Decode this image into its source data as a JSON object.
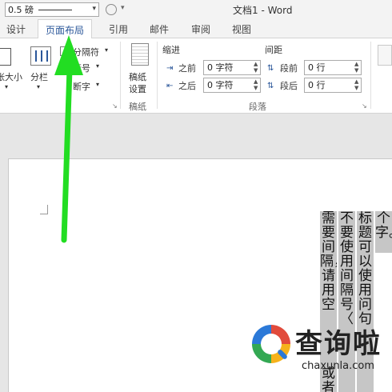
{
  "toolbar": {
    "border_weight": "0.5 磅",
    "circle_caret": "▾",
    "combo_caret": "▾"
  },
  "window": {
    "title": "文档1 - Word"
  },
  "tabs": [
    {
      "label": "设计"
    },
    {
      "label": "页面布局"
    },
    {
      "label": "引用"
    },
    {
      "label": "邮件"
    },
    {
      "label": "审阅"
    },
    {
      "label": "视图"
    }
  ],
  "ribbon": {
    "page_setup": {
      "size": "纸张大小",
      "size_caret": "▾",
      "columns": "分栏",
      "columns_caret": "▾",
      "breaks": "分隔符",
      "breaks_caret": "▾",
      "line_numbers": "行号",
      "line_numbers_caret": "▾",
      "hyphenation": "断字",
      "hyphenation_caret": "▾",
      "launcher": "↘"
    },
    "manuscript": {
      "label_line1": "稿纸",
      "label_line2": "设置",
      "group": "稿纸"
    },
    "paragraph": {
      "indent_header": "缩进",
      "spacing_header": "间距",
      "indent_before_label": "之前",
      "indent_before_value": "0 字符",
      "indent_after_label": "之后",
      "indent_after_value": "0 字符",
      "spacing_before_label": "段前",
      "spacing_before_value": "0 行",
      "spacing_after_label": "段后",
      "spacing_after_value": "0 行",
      "group": "段落",
      "launcher": "↘",
      "spin_arrows": "▲▼"
    }
  },
  "document": {
    "columns": [
      "个字。",
      "标题可以使用问句",
      "不要使用间隔号〈",
      "需要间隔，请用空",
      "或者"
    ]
  },
  "watermark": {
    "name": "查询啦",
    "domain": "chaxunla.com"
  },
  "colors": {
    "accent": "#2b579a",
    "arrow": "#22dd22"
  }
}
